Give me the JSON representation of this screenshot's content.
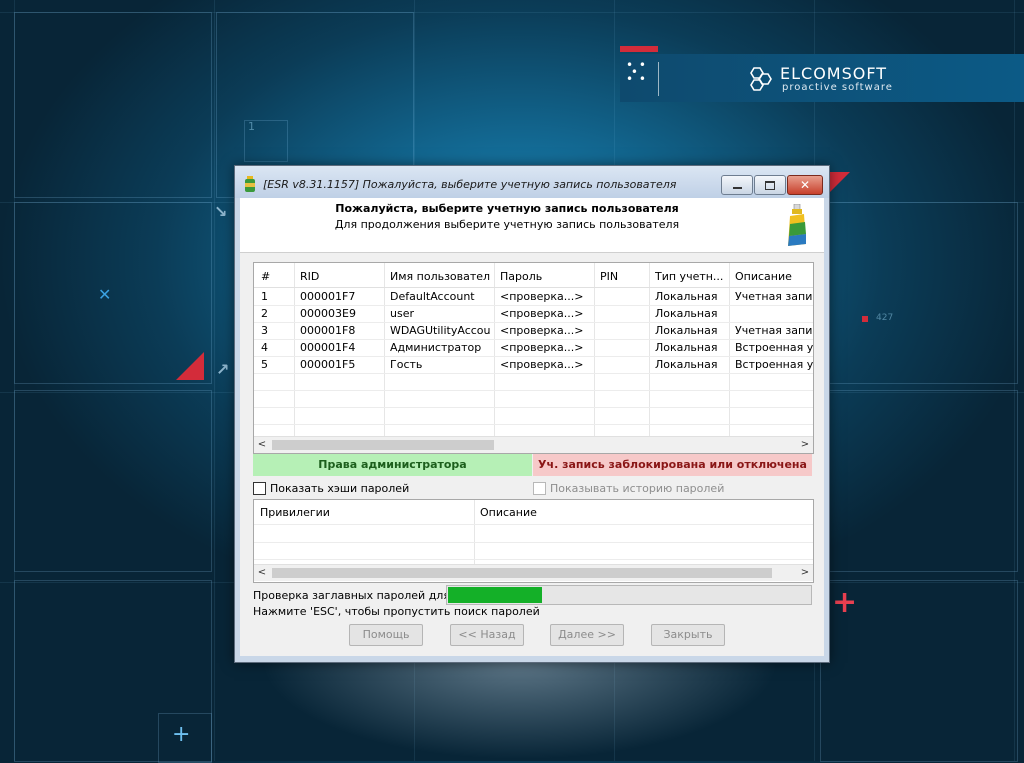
{
  "background": {
    "deco_number_1": "1",
    "deco_number_2": "427",
    "banner": {
      "title": "ELCOMSOFT",
      "subtitle": "proactive software"
    }
  },
  "dialog": {
    "title": "[ESR v8.31.1157]  Пожалуйста, выберите учетную запись пользователя",
    "header": {
      "title": "Пожалуйста, выберите учетную запись пользователя",
      "subtitle": "Для продолжения выберите учетную запись пользователя"
    },
    "accounts_table": {
      "columns": [
        "#",
        "RID",
        "Имя пользователя",
        "Пароль",
        "PIN",
        "Тип учетн...",
        "Описание"
      ],
      "rows": [
        [
          "1",
          "000001F7",
          "DefaultAccount",
          "<проверка...>",
          "",
          "Локальная",
          "Учетная запис"
        ],
        [
          "2",
          "000003E9",
          "user",
          "<проверка...>",
          "",
          "Локальная",
          ""
        ],
        [
          "3",
          "000001F8",
          "WDAGUtilityAccount",
          "<проверка...>",
          "",
          "Локальная",
          "Учетная запис"
        ],
        [
          "4",
          "000001F4",
          "Администратор",
          "<проверка...>",
          "",
          "Локальная",
          "Встроенная уч"
        ],
        [
          "5",
          "000001F5",
          "Гость",
          "<проверка...>",
          "",
          "Локальная",
          "Встроенная уч"
        ]
      ],
      "scroll_left": "<",
      "scroll_right": ">"
    },
    "legend": {
      "admin": "Права администратора",
      "locked": "Уч. запись заблокирована или отключена",
      "admin_color": "#b6f0b6",
      "locked_color": "#f6c9c9"
    },
    "options": {
      "show_hashes": "Показать хэши паролей",
      "show_hashes_checked": false,
      "show_history": "Показывать историю паролей",
      "show_history_checked": false,
      "show_history_enabled": false
    },
    "privileges_table": {
      "columns": [
        "Привилегии",
        "Описание"
      ],
      "scroll_left": "<",
      "scroll_right": ">"
    },
    "status": {
      "line1": "Проверка заглавных паролей для NT",
      "line2": "Нажмите 'ESC', чтобы пропустить поиск паролей",
      "progress_fraction": 0.26,
      "progress_color": "#14b028"
    },
    "buttons": {
      "help": "Помощь",
      "back": "<< Назад",
      "next": "Далее >>",
      "close": "Закрыть"
    }
  }
}
